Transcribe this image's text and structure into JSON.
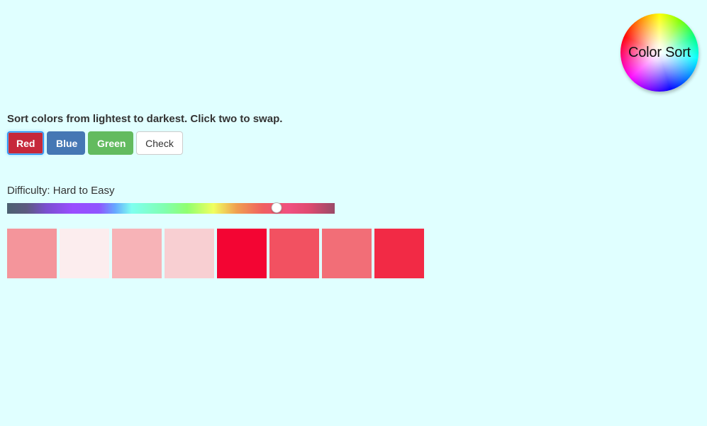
{
  "logo": {
    "text": "Color Sort"
  },
  "instructions": "Sort colors from lightest to darkest. Click two to swap.",
  "color_buttons": [
    {
      "label": "Red",
      "color": "#c6283a",
      "selected": true
    },
    {
      "label": "Blue",
      "color": "#4577b4",
      "selected": false
    },
    {
      "label": "Green",
      "color": "#63bb5f",
      "selected": false
    }
  ],
  "check_button": {
    "label": "Check"
  },
  "difficulty": {
    "label": "Difficulty: Hard to Easy",
    "value_fraction": 0.823
  },
  "swatches": [
    {
      "color": "#f4959b"
    },
    {
      "color": "#fcedee"
    },
    {
      "color": "#f7b3b7"
    },
    {
      "color": "#f8cfd2"
    },
    {
      "color": "#f30533"
    },
    {
      "color": "#f25161"
    },
    {
      "color": "#f26e77"
    },
    {
      "color": "#f22a45"
    }
  ],
  "colors": {
    "background": "#e0ffff"
  }
}
